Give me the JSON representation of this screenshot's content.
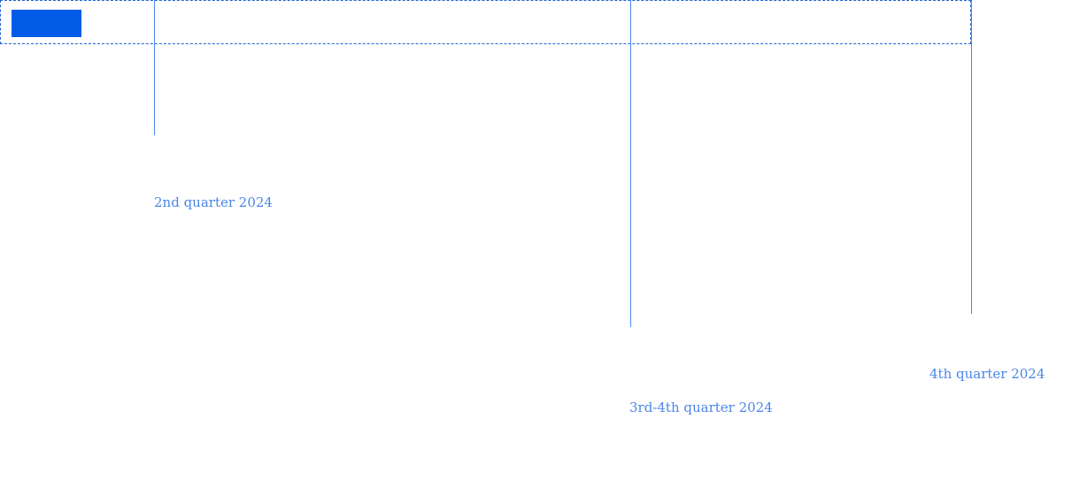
{
  "colors": {
    "frame": "#1f62d6",
    "marker": "#005ce6",
    "line": "#4a86e8",
    "label": "#4a86e8"
  },
  "milestones": [
    {
      "label": "2nd quarter 2024"
    },
    {
      "label": "3rd-4th quarter 2024"
    },
    {
      "label": "4th quarter 2024"
    }
  ]
}
